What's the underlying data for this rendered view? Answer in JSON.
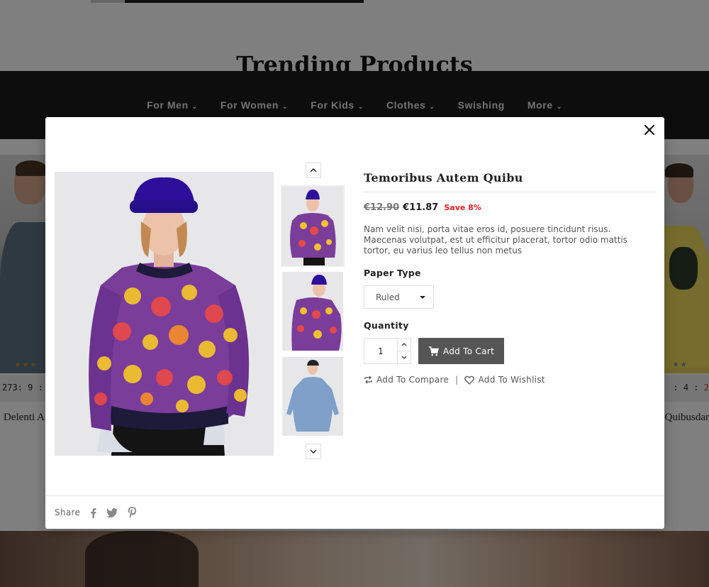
{
  "background": {
    "section_title": "Trending Products",
    "nav": [
      {
        "label": "For Men",
        "has_dropdown": true
      },
      {
        "label": "For Women",
        "has_dropdown": true
      },
      {
        "label": "For Kids",
        "has_dropdown": true
      },
      {
        "label": "Clothes",
        "has_dropdown": true
      },
      {
        "label": "Swishing",
        "has_dropdown": false
      },
      {
        "label": "More",
        "has_dropdown": true
      }
    ],
    "left_card": {
      "timer": "273: 9 :",
      "name": "Delenti A",
      "stars": "★★★"
    },
    "right_card": {
      "timer_a": ": 4 :",
      "timer_b": "2",
      "name": "Quibusdar",
      "stars": "★★"
    }
  },
  "modal": {
    "product_title": "Temoribus Autem Quibu",
    "old_price": "€12.90",
    "price": "€11.87",
    "discount": "Save 8%",
    "description": "Nam velit nisi, porta vitae eros id, posuere tincidunt risus. Maecenas volutpat, est ut efficitur placerat, tortor odio mattis tortor, eu varius leo tellus non metus",
    "paper_type_label": "Paper Type",
    "paper_type_value": "Ruled",
    "quantity_label": "Quantity",
    "quantity_value": "1",
    "add_to_cart": "Add To Cart",
    "add_to_compare": "Add To Compare",
    "add_to_wishlist": "Add To Wishlist",
    "share_label": "Share",
    "close_icon": "close-icon",
    "social_icons": [
      "facebook-icon",
      "twitter-icon",
      "pinterest-icon"
    ]
  },
  "colors": {
    "accent_red": "#e0201f",
    "cart_button": "#555555",
    "nav_bg": "#1b1b1b"
  }
}
